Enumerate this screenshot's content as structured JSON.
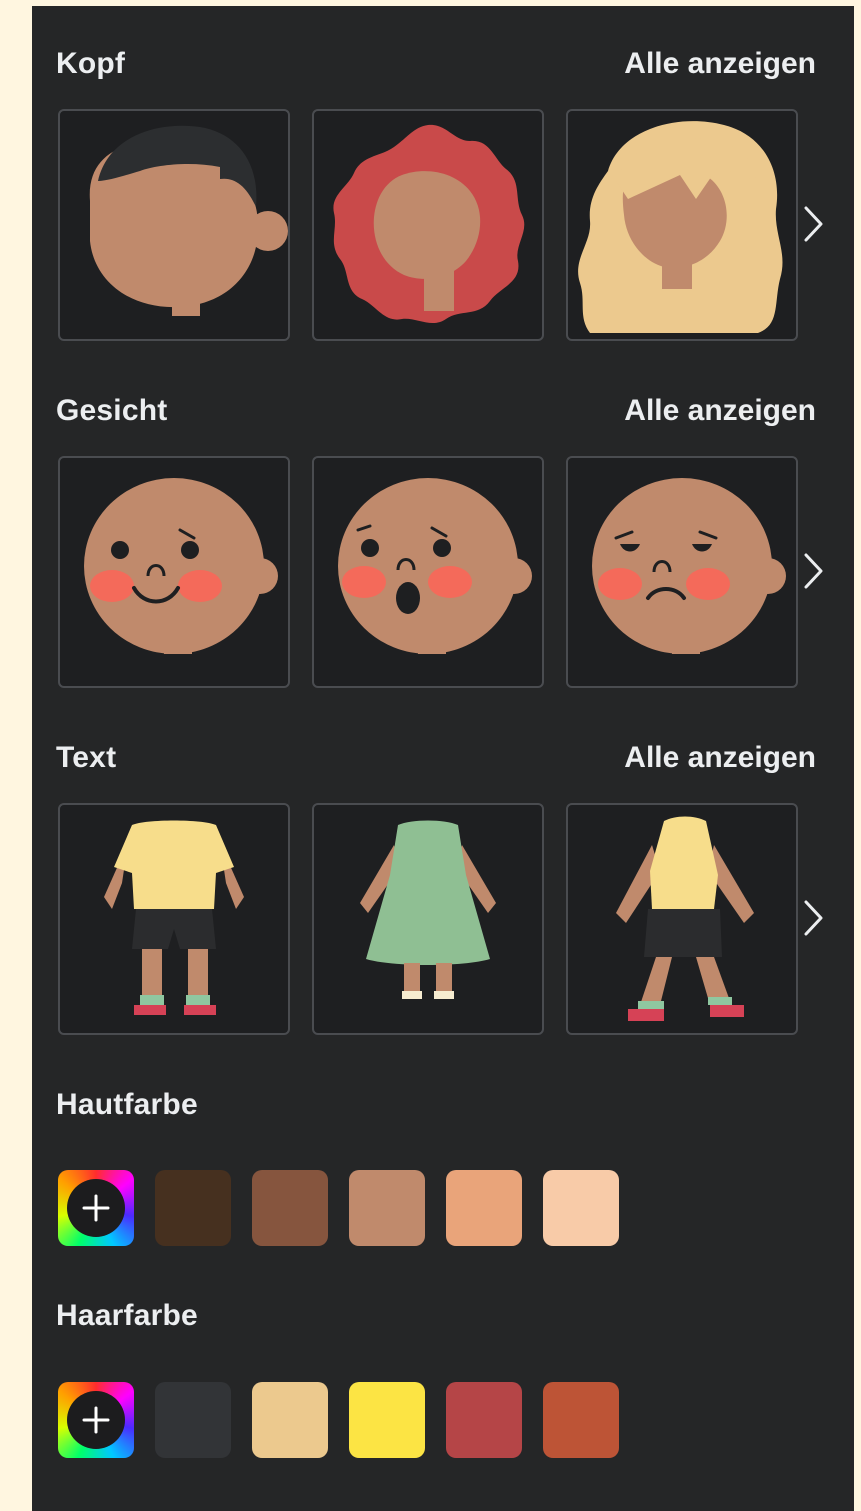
{
  "sections": {
    "kopf": {
      "title": "Kopf",
      "show_all": "Alle anzeigen"
    },
    "gesicht": {
      "title": "Gesicht",
      "show_all": "Alle anzeigen"
    },
    "text": {
      "title": "Text",
      "show_all": "Alle anzeigen"
    }
  },
  "hautfarbe": {
    "title": "Hautfarbe",
    "add_icon": "add-color-icon",
    "colors": [
      "#46301f",
      "#86553e",
      "#c08a6c",
      "#e9a47a",
      "#f8cba8"
    ]
  },
  "haarfarbe": {
    "title": "Haarfarbe",
    "add_icon": "add-color-icon",
    "colors": [
      "#323437",
      "#ecc98e",
      "#fce444",
      "#b54547",
      "#bd5436"
    ]
  },
  "icons": {
    "next": "chevron-right-icon"
  }
}
